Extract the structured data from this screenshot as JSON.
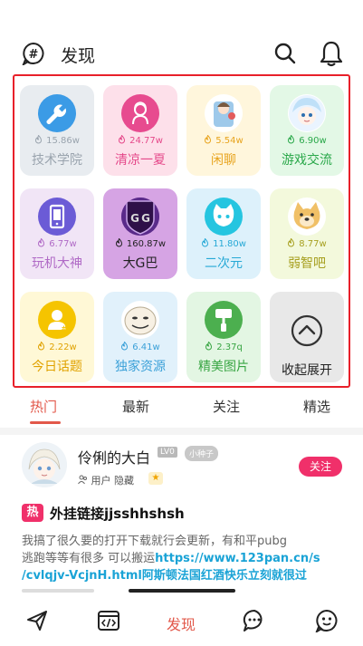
{
  "header": {
    "title": "发现"
  },
  "grid": {
    "tiles": [
      {
        "name": "技术学院",
        "stat": "15.86w",
        "bg": "#e8ecf0",
        "icon_bg": "#3b9be6",
        "text_color": "#9aa4ae",
        "icon": "wrench-icon"
      },
      {
        "name": "清凉一夏",
        "stat": "24.77w",
        "bg": "#fde0ea",
        "icon_bg": "#e74b8f",
        "text_color": "#e5488a",
        "icon": "woman-icon"
      },
      {
        "name": "闲聊",
        "stat": "5.54w",
        "bg": "#fff6dc",
        "icon_bg": "#ffffff",
        "text_color": "#e8a41e",
        "icon": "anime-avatar-icon"
      },
      {
        "name": "游戏交流",
        "stat": "6.90w",
        "bg": "#e3f8e6",
        "icon_bg": "#ffffff",
        "text_color": "#2aa84a",
        "icon": "anime-girl-icon"
      },
      {
        "name": "玩机大神",
        "stat": "6.77w",
        "bg": "#f1e5f6",
        "icon_bg": "#6b5bd6",
        "text_color": "#b06ac6",
        "icon": "phone-icon"
      },
      {
        "name": "大G巴",
        "stat": "160.87w",
        "bg": "#d6a4e4",
        "icon_bg": "#5a2a8a",
        "text_color": "#222222",
        "icon": "game-guardian-icon"
      },
      {
        "name": "二次元",
        "stat": "11.80w",
        "bg": "#ddf1fb",
        "icon_bg": "#25c5e0",
        "text_color": "#27a9d6",
        "icon": "cat-face-icon"
      },
      {
        "name": "弱智吧",
        "stat": "8.77w",
        "bg": "#f3f9dc",
        "icon_bg": "#ffffff",
        "text_color": "#a7a020",
        "icon": "doge-icon"
      },
      {
        "name": "今日话题",
        "stat": "2.22w",
        "bg": "#fff8d6",
        "icon_bg": "#f5c400",
        "text_color": "#e0a200",
        "icon": "user-topic-icon"
      },
      {
        "name": "独家资源",
        "stat": "6.41w",
        "bg": "#e1f1fb",
        "icon_bg": "#ffffff",
        "text_color": "#3aa0d8",
        "icon": "meme-face-icon"
      },
      {
        "name": "精美图片",
        "stat": "2.37q",
        "bg": "#e3f6e3",
        "icon_bg": "#4caf4f",
        "text_color": "#38a543",
        "icon": "paint-icon"
      },
      {
        "name": "收起展开",
        "stat": "",
        "bg": "#e8e8e8",
        "icon_bg": "#e8e8e8",
        "text_color": "#222222",
        "icon": "chevron-up-icon"
      }
    ]
  },
  "tabs": [
    {
      "label": "热门",
      "active": true
    },
    {
      "label": "最新",
      "active": false
    },
    {
      "label": "关注",
      "active": false
    },
    {
      "label": "精选",
      "active": false
    }
  ],
  "post": {
    "username": "伶俐的大白",
    "lv_badge": "LV0",
    "title_badge": "小种子",
    "user_line": "用户 隐藏",
    "follow_label": "关注",
    "hot_label": "热",
    "title": "外挂链接jjsshhshsh",
    "body_line1": "我搞了很久要的打开下载就行会更新，有和平pubg",
    "body_line2_pre": "逃跑等等有很多   可以搬运",
    "body_line2_link": "https://www.123pan.cn/s",
    "body_line3": "/cvlqjv-VcjnH.html阿斯顿法国红酒快乐立刻就很过"
  },
  "bottom_nav": {
    "active_label": "发现"
  },
  "colors": {
    "accent": "#e2584a",
    "highlight_border": "#e8202a"
  }
}
